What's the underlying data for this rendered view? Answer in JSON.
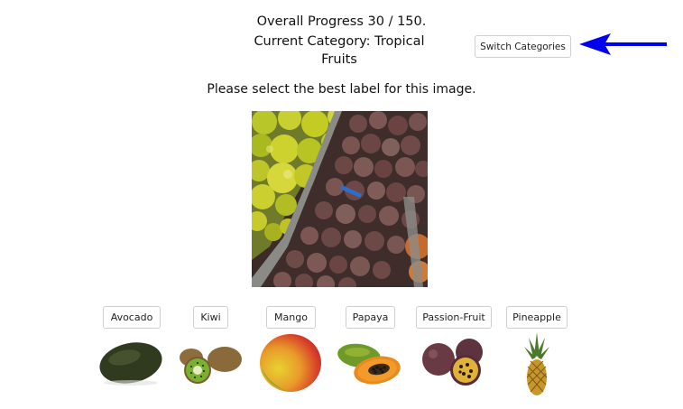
{
  "header": {
    "progress_text": "Overall Progress 30 / 150.",
    "category_text": "Current Category: Tropical Fruits",
    "switch_button_label": "Switch Categories"
  },
  "prompt": "Please select the best label for this image.",
  "labels": [
    {
      "label": "Avocado",
      "icon": "avocado-icon"
    },
    {
      "label": "Kiwi",
      "icon": "kiwi-icon"
    },
    {
      "label": "Mango",
      "icon": "mango-icon"
    },
    {
      "label": "Papaya",
      "icon": "papaya-icon"
    },
    {
      "label": "Passion-Fruit",
      "icon": "passion-fruit-icon"
    },
    {
      "label": "Pineapple",
      "icon": "pineapple-icon"
    }
  ],
  "colors": {
    "arrow": "#0000ee",
    "button_border": "#cfcfcf"
  }
}
